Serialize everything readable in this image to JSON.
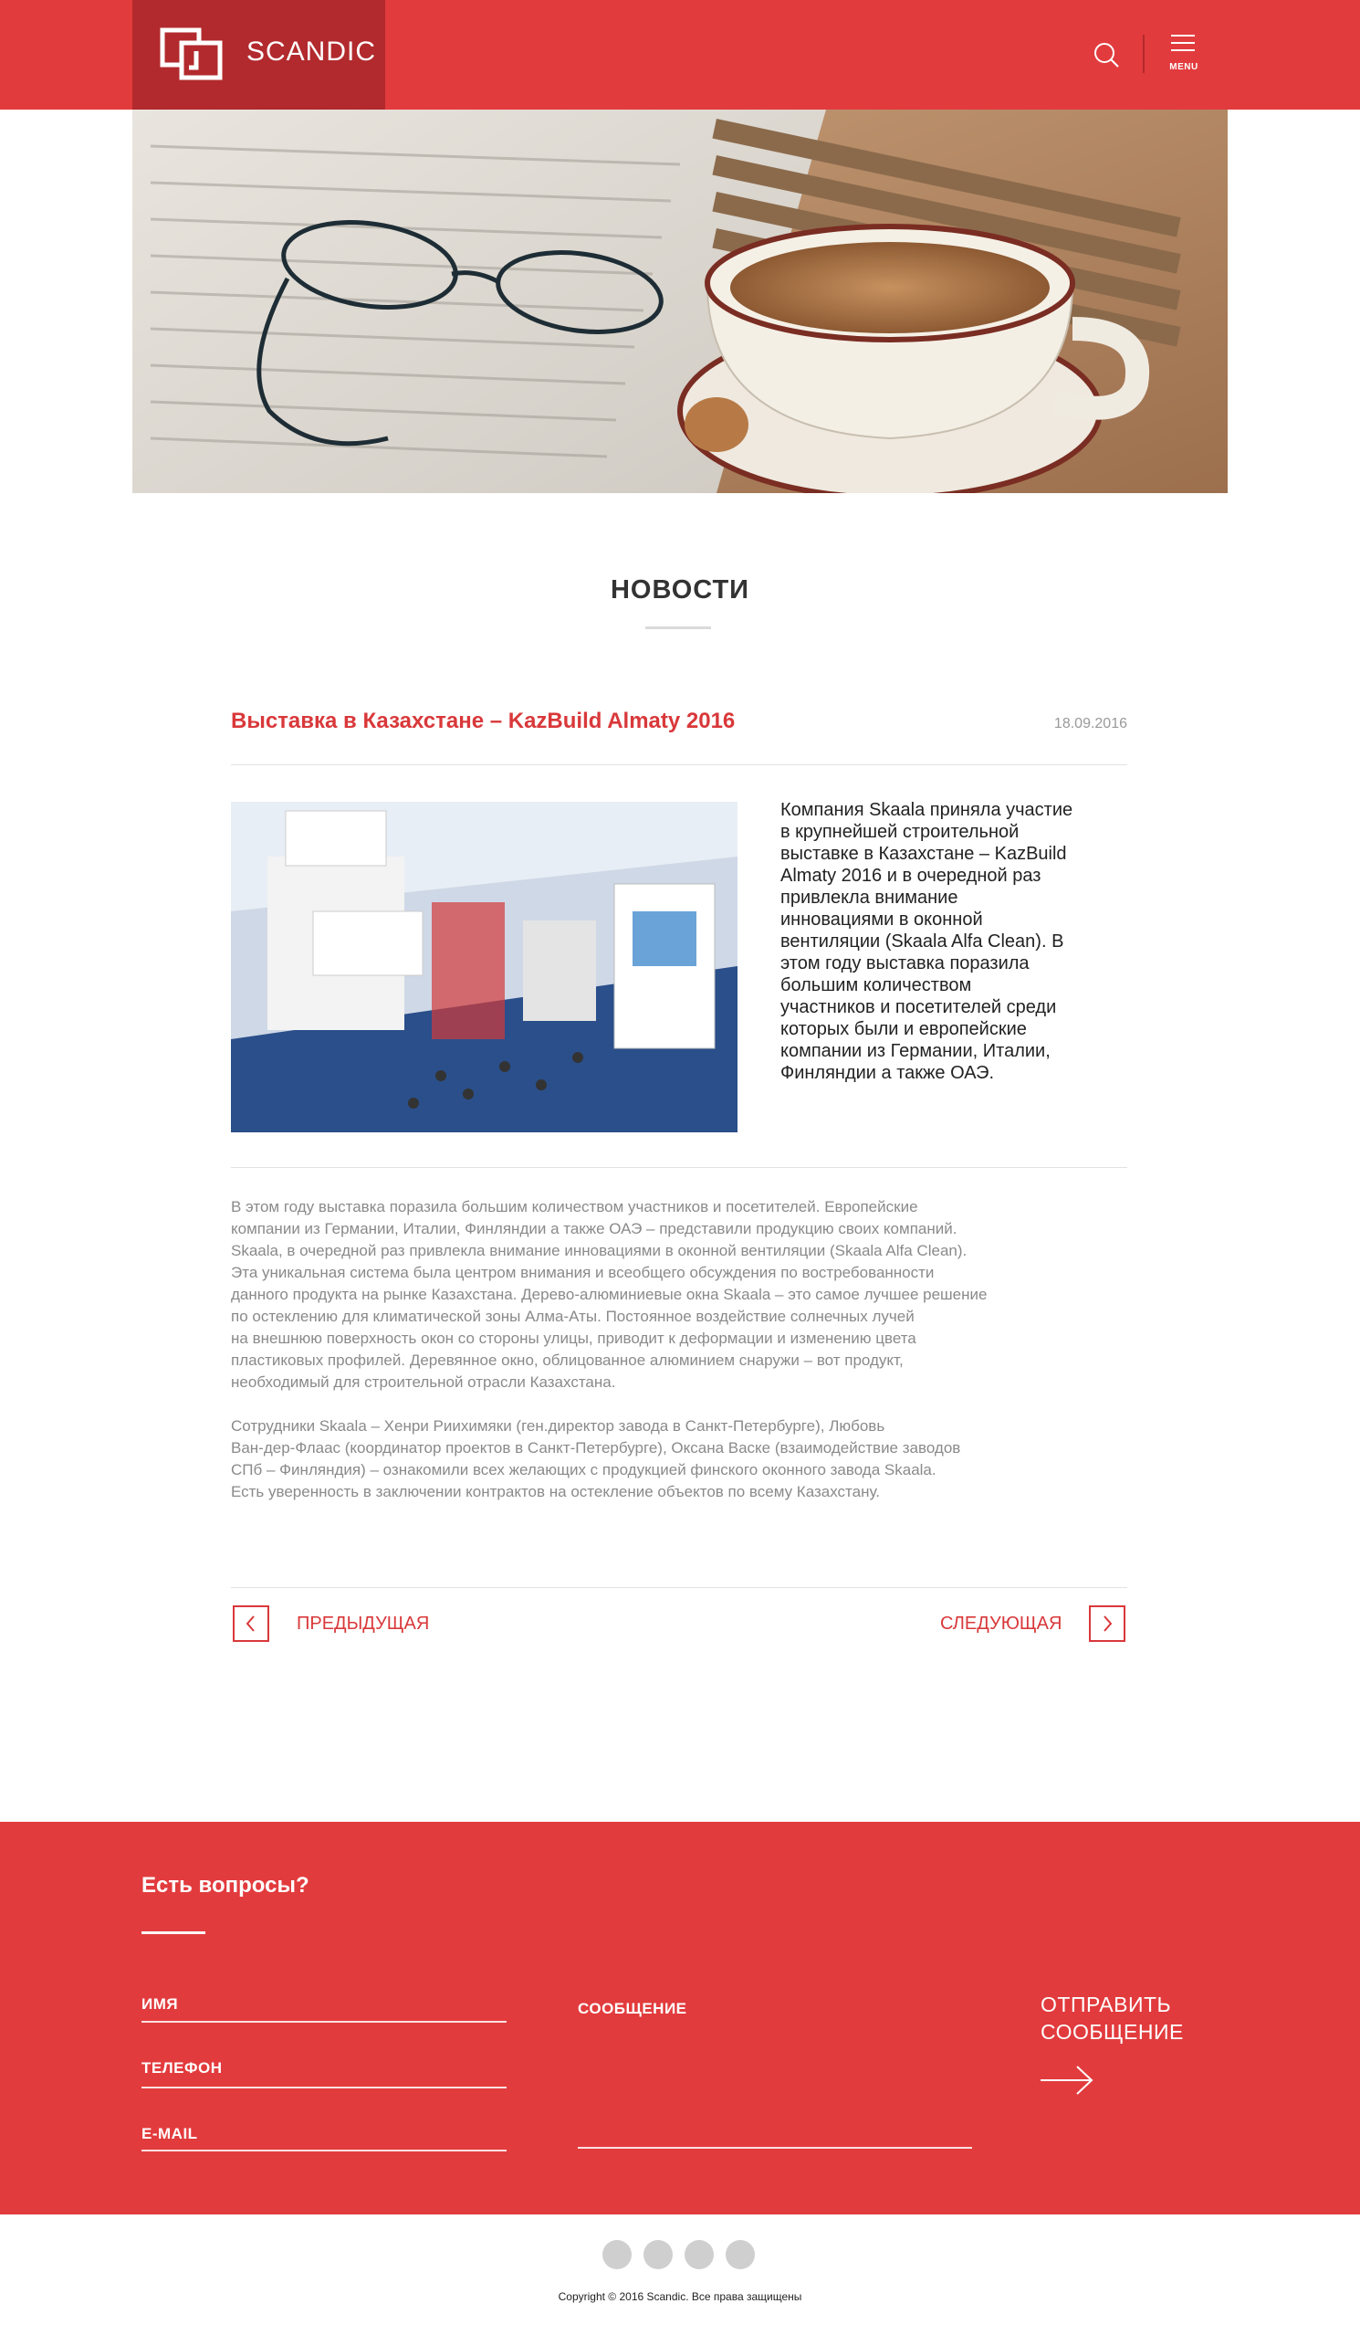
{
  "header": {
    "brand": "SCANDIC",
    "menu_label": "MENU"
  },
  "news": {
    "section_title": "НОВОСТИ",
    "article": {
      "title": "Выставка в Казахстане – KazBuild Almaty 2016",
      "date": "18.09.2016",
      "lead_lines": [
        "Компания Skaala приняла участие",
        "в крупнейшей строительной",
        "выставке в Казахстане – KazBuild",
        "Almaty 2016 и в очередной раз",
        "привлекла внимание",
        "инновациями в оконной",
        "вентиляции (Skaala Alfa Clean). В",
        "этом году выставка поразила",
        "большим количеством",
        "участников и посетителей среди",
        "которых были и европейские",
        "компании из Германии, Италии,",
        "Финляндии а также ОАЭ."
      ],
      "body_paragraph_1": [
        "В этом году выставка поразила большим количеством участников и посетителей. Европейские",
        "компании из Германии, Италии, Финляндии а также ОАЭ – представили продукцию своих компаний.",
        "Skaala, в очередной раз привлекла внимание инновациями в оконной вентиляции (Skaala Alfa Clean).",
        "Эта уникальная система была центром внимания и всеобщего обсуждения по востребованности",
        "данного продукта на рынке Казахстана. Дерево-алюминиевые окна Skaala – это самое лучшее решение",
        "по остеклению для климатической зоны Алма-Аты. Постоянное воздействие солнечных лучей",
        "на внешнюю поверхность окон со стороны улицы, приводит к деформации и изменению цвета",
        "пластиковых профилей. Деревянное окно, облицованное алюминием снаружи – вот продукт,",
        "необходимый для строительной отрасли Казахстана."
      ],
      "body_paragraph_2": [
        "Сотрудники Skaala – Хенри Риихимяки (ген.директор завода в Санкт-Петербурге), Любовь",
        "Ван-дер-Флаас (координатор проектов в Санкт-Петербурге), Оксана Васке (взаимодействие заводов",
        "СПб – Финляндия) – ознакомили всех желающих с продукцией финского оконного завода Skaala.",
        "Есть уверенность в заключении контрактов на остекление объектов по всему Казахстану."
      ]
    },
    "pager": {
      "prev": "ПРЕДЫДУЩАЯ",
      "next": "СЛЕДУЮЩАЯ"
    }
  },
  "contact": {
    "title": "Есть вопросы?",
    "name_label": "ИМЯ",
    "phone_label": "ТЕЛЕФОН",
    "email_label": "E-MAIL",
    "message_label": "СООБЩЕНИЕ",
    "send_line1": "ОТПРАВИТЬ",
    "send_line2": "СООБЩЕНИЕ"
  },
  "footer": {
    "copyright": "Copyright © 2016 Scandic. Все права защищены"
  },
  "colors": {
    "brand_red": "#e23b3d",
    "brand_dark_red": "#b22a2d",
    "accent_red": "#d9383a"
  },
  "icons": [
    "logo-icon",
    "search-icon",
    "menu-icon",
    "chevron-left-icon",
    "chevron-right-icon",
    "arrow-right-icon"
  ]
}
